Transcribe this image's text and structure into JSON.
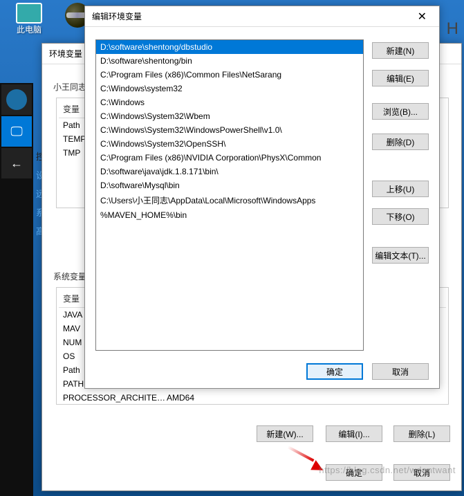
{
  "desktop": {
    "pc_label": "此电脑"
  },
  "topright_H": "H",
  "env_window": {
    "title": "环境变量",
    "user_group": "小王同志的用户变量",
    "sys_group": "系统变量",
    "user_table": {
      "header0": "变量",
      "rows": [
        "Path",
        "TEMP",
        "TMP"
      ]
    },
    "sys_table": {
      "header0": "变量",
      "rows": [
        {
          "n": "JAVA",
          "v": ""
        },
        {
          "n": "MAV",
          "v": ""
        },
        {
          "n": "NUM",
          "v": ""
        },
        {
          "n": "OS",
          "v": ""
        },
        {
          "n": "Path",
          "v": ""
        },
        {
          "n": "PATH",
          "v": ""
        },
        {
          "n": "PROCESSOR_ARCHITECT...",
          "v": "AMD64"
        }
      ]
    },
    "btn_new": "新建(W)...",
    "btn_edit": "编辑(I)...",
    "btn_del": "删除(L)",
    "btn_ok": "确定",
    "btn_cancel": "取消"
  },
  "edit_window": {
    "title": "编辑环境变量",
    "entries": [
      "D:\\software\\shentong/dbstudio",
      "D:\\software\\shentong/bin",
      "C:\\Program Files (x86)\\Common Files\\NetSarang",
      "C:\\Windows\\system32",
      "C:\\Windows",
      "C:\\Windows\\System32\\Wbem",
      "C:\\Windows\\System32\\WindowsPowerShell\\v1.0\\",
      "C:\\Windows\\System32\\OpenSSH\\",
      "C:\\Program Files (x86)\\NVIDIA Corporation\\PhysX\\Common",
      "D:\\software\\java\\jdk.1.8.171\\bin\\",
      "D:\\software\\Mysql\\bin",
      "C:\\Users\\小王同志\\AppData\\Local\\Microsoft\\WindowsApps",
      "%MAVEN_HOME%\\bin"
    ],
    "selected_index": 0,
    "btn_new": "新建(N)",
    "btn_edit": "编辑(E)",
    "btn_browse": "浏览(B)...",
    "btn_delete": "删除(D)",
    "btn_up": "上移(U)",
    "btn_down": "下移(O)",
    "btn_txt": "编辑文本(T)...",
    "btn_ok": "确定",
    "btn_cancel": "取消"
  },
  "sidebar_labels": [
    "控",
    "设",
    "远",
    "系",
    "高"
  ],
  "sys_footer": "系",
  "watermark": "https://blog.csdn.net/wdontwant"
}
